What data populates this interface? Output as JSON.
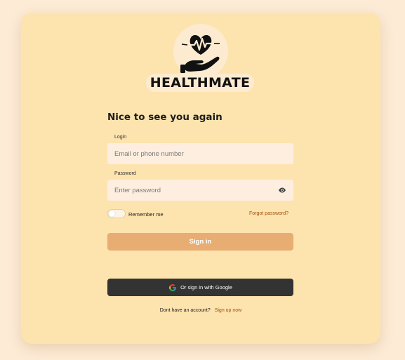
{
  "brand": {
    "name": "HEALTHMATE"
  },
  "form": {
    "heading": "Nice to see you again",
    "login_label": "Login",
    "login_placeholder": "Email or phone number",
    "password_label": "Password",
    "password_placeholder": "Enter password",
    "remember_label": "Remember me",
    "remember_checked": false,
    "forgot_label": "Forgot password?",
    "signin_label": "Sign in",
    "google_label": "Or sign in with Google"
  },
  "footer": {
    "prompt": "Dont have an account?",
    "signup_label": "Sign up now"
  },
  "icons": {
    "logo": "heart-in-hand-icon",
    "password_toggle": "eye-icon",
    "google": "google-icon"
  },
  "colors": {
    "page_bg": "#fdebd6",
    "card_bg": "#fde3ad",
    "input_bg": "#fdeedf",
    "primary_button": "#e8ad72",
    "google_button": "#333333",
    "link": "#a0520f"
  }
}
